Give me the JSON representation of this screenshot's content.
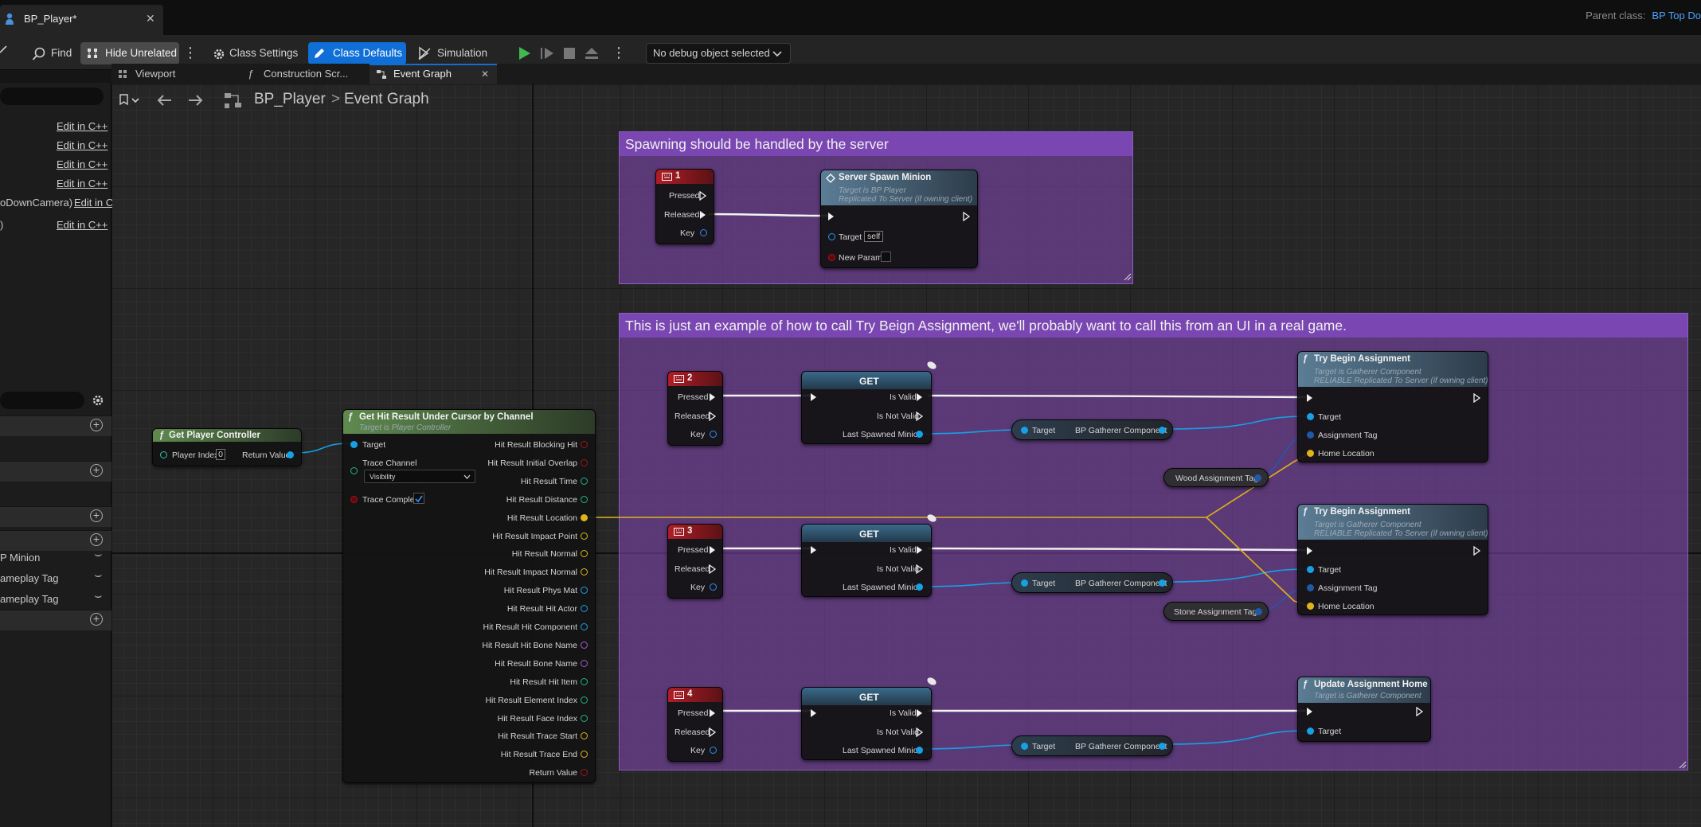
{
  "title_tab": {
    "label": "BP_Player*",
    "close": "✕"
  },
  "parent_class": {
    "label": "Parent class:",
    "value": "BP Top Do"
  },
  "toolbar": {
    "find": "Find",
    "hide_unrelated": "Hide Unrelated",
    "class_settings": "Class Settings",
    "class_defaults": "Class Defaults",
    "simulation": "Simulation",
    "debug_object": "No debug object selected"
  },
  "editor_tabs": {
    "viewport": "Viewport",
    "construction": "Construction Scr...",
    "event_graph": "Event Graph"
  },
  "breadcrumb": {
    "blueprint": "BP_Player",
    "separator": ">",
    "graph": "Event Graph"
  },
  "sidebar": {
    "edit_links": [
      {
        "prefix": "",
        "link": "Edit in C++"
      },
      {
        "prefix": "",
        "link": "Edit in C++"
      },
      {
        "prefix": "",
        "link": "Edit in C++"
      },
      {
        "prefix": "",
        "link": "Edit in C++"
      },
      {
        "prefix": "oDownCamera)",
        "link": "Edit in C"
      },
      {
        "prefix": ")",
        "link": "Edit in C++"
      }
    ],
    "variables": [
      "P Minion",
      "ameplay Tag",
      "ameplay Tag"
    ]
  },
  "comments": {
    "server": "Spawning should be handled by the server",
    "example": "This is just an example of how to call Try Beign Assignment, we'll probably want to call this from an UI in a real game."
  },
  "nodes": {
    "get_player_controller": {
      "title": "Get Player Controller",
      "player_index_label": "Player Index",
      "player_index": "0",
      "return_value": "Return Value"
    },
    "hit_result": {
      "title": "Get Hit Result Under Cursor by Channel",
      "subtitle": "Target is Player Controller",
      "target": "Target",
      "trace_channel": "Trace Channel",
      "trace_channel_value": "Visibility",
      "trace_complex": "Trace Complex",
      "outputs": [
        "Hit Result Blocking Hit",
        "Hit Result Initial Overlap",
        "Hit Result Time",
        "Hit Result Distance",
        "Hit Result Location",
        "Hit Result Impact Point",
        "Hit Result Normal",
        "Hit Result Impact Normal",
        "Hit Result Phys Mat",
        "Hit Result Hit Actor",
        "Hit Result Hit Component",
        "Hit Result Hit Bone Name",
        "Hit Result Bone Name",
        "Hit Result Hit Item",
        "Hit Result Element Index",
        "Hit Result Face Index",
        "Hit Result Trace Start",
        "Hit Result Trace End",
        "Return Value"
      ]
    },
    "key1": {
      "title": "1",
      "pressed": "Pressed",
      "released": "Released",
      "key": "Key"
    },
    "key2": {
      "title": "2",
      "pressed": "Pressed",
      "released": "Released",
      "key": "Key"
    },
    "key3": {
      "title": "3",
      "pressed": "Pressed",
      "released": "Released",
      "key": "Key"
    },
    "key4": {
      "title": "4",
      "pressed": "Pressed",
      "released": "Released",
      "key": "Key"
    },
    "server_spawn": {
      "title": "Server Spawn Minion",
      "subtitle1": "Target is BP Player",
      "subtitle2": "Replicated To Server (if owning client)",
      "target": "Target",
      "target_value": "self",
      "new_param": "New Param"
    },
    "get": {
      "title": "GET",
      "is_valid": "Is Valid",
      "is_not_valid": "Is Not Valid",
      "last_spawned": "Last Spawned Minion"
    },
    "gatherer": {
      "target": "Target",
      "component": "BP Gatherer Component"
    },
    "wood_tag": "Wood Assignment Tag",
    "stone_tag": "Stone Assignment Tag",
    "try_begin": {
      "title": "Try Begin Assignment",
      "subtitle1": "Target is Gatherer Component",
      "subtitle2": "RELIABLE Replicated To Server (if owning client)",
      "target": "Target",
      "assignment_tag": "Assignment Tag",
      "home_location": "Home Location"
    },
    "update_home": {
      "title": "Update Assignment Home",
      "subtitle": "Target is Gatherer Component",
      "target": "Target"
    }
  }
}
